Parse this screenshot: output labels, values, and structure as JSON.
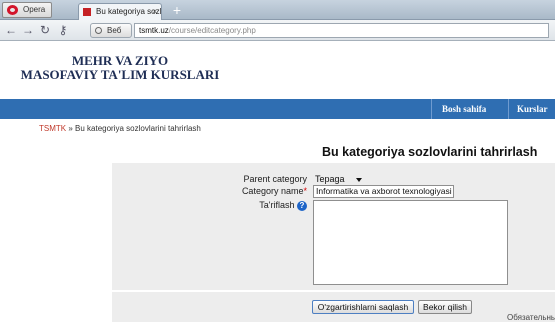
{
  "browser": {
    "menu_label": "Opera",
    "tab_title": "Bu kategoriya sozlovlar...",
    "tab_close": "×",
    "new_tab": "+",
    "mode_label": "Веб",
    "url_domain": "tsmtk.uz",
    "url_path": "/course/editcategory.php"
  },
  "site": {
    "title_line1": "MEHR VA ZIYO",
    "title_line2": "MASOFAVIY TA'LIM KURSLARI",
    "nav": [
      {
        "label": "Bosh sahifa"
      },
      {
        "label": "Kurslar"
      }
    ],
    "accent_color": "#2f6eb2"
  },
  "breadcrumb": {
    "root": "TSMTK",
    "separator": "»",
    "current": "Bu kategoriya sozlovlarini tahrirlash"
  },
  "page": {
    "heading": "Bu kategoriya sozlovlarini tahrirlash"
  },
  "form": {
    "parent_label": "Parent category",
    "parent_value": "Tepaga",
    "name_label": "Category name",
    "required_mark": "*",
    "name_value": "Informatika va axborot texnologiyasi",
    "description_label": "Ta'riflash",
    "help_glyph": "?",
    "description_value": ""
  },
  "buttons": {
    "save": "O'zgartirishlarni saqlash",
    "cancel": "Bekor qilish"
  },
  "required_note": "Обязательные д"
}
